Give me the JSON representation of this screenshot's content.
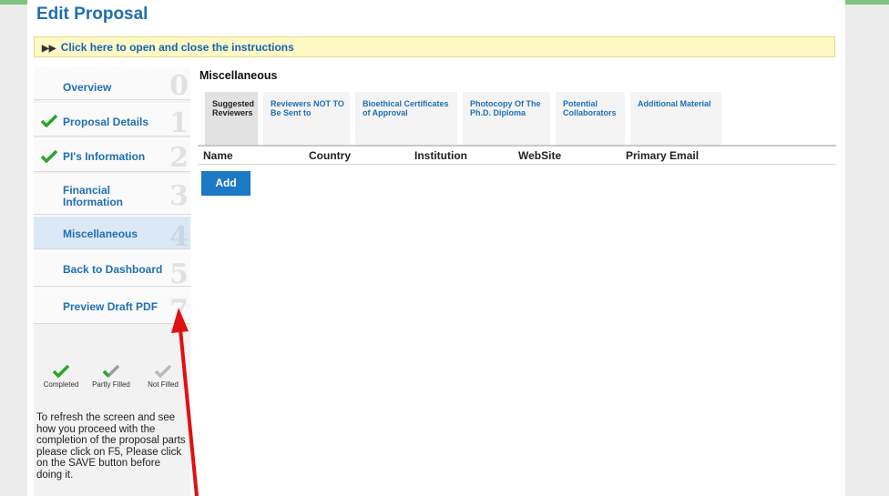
{
  "page_title": "Edit Proposal",
  "instructions_toggle": "Click here to open and close the instructions",
  "sidebar": {
    "items": [
      {
        "label": "Overview",
        "num": "0",
        "status": "none"
      },
      {
        "label": "Proposal Details",
        "num": "1",
        "status": "completed"
      },
      {
        "label": "PI's Information",
        "num": "2",
        "status": "completed"
      },
      {
        "label": "Financial Information",
        "num": "3",
        "status": "none"
      },
      {
        "label": "Miscellaneous",
        "num": "4",
        "status": "active"
      },
      {
        "label": "Back to Dashboard",
        "num": "5",
        "status": "none"
      },
      {
        "label": "Preview Draft PDF",
        "num": "7",
        "status": "none"
      }
    ],
    "legend": {
      "completed": "Completed",
      "partly": "Partly Filled",
      "not_filled": "Not Filled"
    },
    "refresh_text": "To refresh the screen and see how you proceed with the completion of the proposal parts please click on F5, Please click on the SAVE button before doing it."
  },
  "main": {
    "section_title": "Miscellaneous",
    "tabs": [
      {
        "label": "Suggested Reviewers"
      },
      {
        "label": "Reviewers NOT TO Be Sent to"
      },
      {
        "label": "Bioethical Certificates of Approval"
      },
      {
        "label": "Photocopy Of The Ph.D. Diploma"
      },
      {
        "label": "Potential Collaborators"
      },
      {
        "label": "Additional Material"
      }
    ],
    "columns": [
      "Name",
      "Country",
      "Institution",
      "WebSite",
      "Primary Email"
    ],
    "add_button": "Add"
  },
  "colors": {
    "accent": "#1f6fb2",
    "button": "#1b79c5",
    "check_green": "#2aa52a",
    "annotation_arrow": "#e01010"
  }
}
